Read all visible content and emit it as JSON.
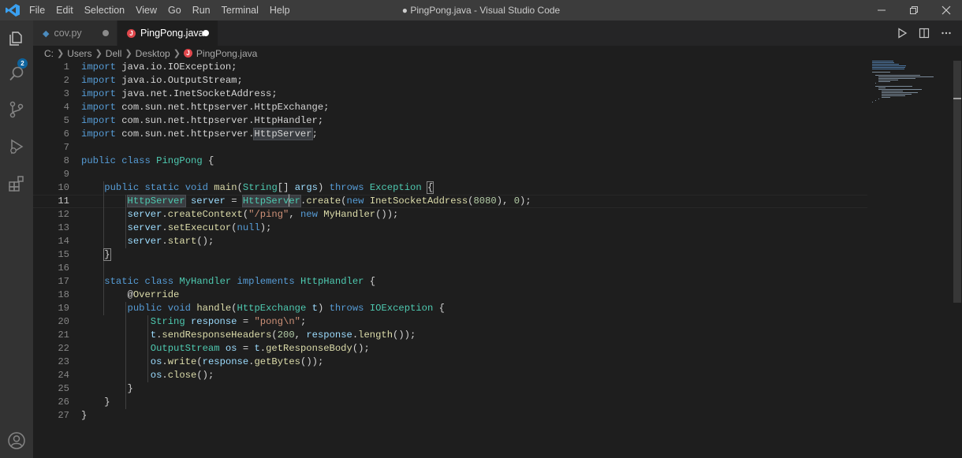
{
  "titlebar": {
    "menu": [
      "File",
      "Edit",
      "Selection",
      "View",
      "Go",
      "Run",
      "Terminal",
      "Help"
    ],
    "window_title": "● PingPong.java - Visual Studio Code"
  },
  "activity": {
    "scm_badge": "2"
  },
  "tabs": [
    {
      "label": "cov.py",
      "icon": "python-icon"
    },
    {
      "label": "PingPong.java",
      "icon": "java-icon"
    }
  ],
  "breadcrumb": [
    "C:",
    "Users",
    "Dell",
    "Desktop",
    "PingPong.java"
  ],
  "editor": {
    "line_numbers": [
      "1",
      "2",
      "3",
      "4",
      "5",
      "6",
      "7",
      "8",
      "9",
      "10",
      "11",
      "12",
      "13",
      "14",
      "15",
      "16",
      "17",
      "18",
      "19",
      "20",
      "21",
      "22",
      "23",
      "24",
      "25",
      "26",
      "27"
    ],
    "current_line": "11",
    "lines": [
      "import java.io.IOException;",
      "import java.io.OutputStream;",
      "import java.net.InetSocketAddress;",
      "import com.sun.net.httpserver.HttpExchange;",
      "import com.sun.net.httpserver.HttpHandler;",
      "import com.sun.net.httpserver.HttpServer;",
      "",
      "public class PingPong {",
      "",
      "    public static void main(String[] args) throws Exception {",
      "        HttpServer server = HttpServer.create(new InetSocketAddress(8080), 0);",
      "        server.createContext(\"/ping\", new MyHandler());",
      "        server.setExecutor(null);",
      "        server.start();",
      "    }",
      "",
      "    static class MyHandler implements HttpHandler {",
      "        @Override",
      "        public void handle(HttpExchange t) throws IOException {",
      "            String response = \"pong\\n\";",
      "            t.sendResponseHeaders(200, response.length());",
      "            OutputStream os = t.getResponseBody();",
      "            os.write(response.getBytes());",
      "            os.close();",
      "        }",
      "    }",
      "}"
    ]
  },
  "colors": {
    "keyword": "#569cd6",
    "type": "#4ec9b0",
    "function": "#dcdcaa",
    "variable": "#9cdcfe",
    "string": "#ce9178",
    "number": "#b5cea8",
    "accent": "#0e639c"
  }
}
